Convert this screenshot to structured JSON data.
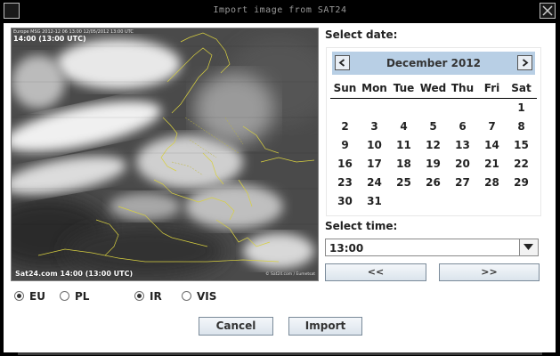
{
  "window": {
    "title": "Import image from SAT24"
  },
  "image": {
    "top_line1": "Europe MSG 2012-12 06 13:00 12/05/2012 13:00 UTC",
    "top_line2": "14:00 (13:00 UTC)",
    "caption": "Sat24.com 14:00 (13:00 UTC)",
    "copyright": "© Sat24.com / Eumetsat"
  },
  "date": {
    "label": "Select date:",
    "month_title": "December 2012",
    "weekdays": [
      "Sun",
      "Mon",
      "Tue",
      "Wed",
      "Thu",
      "Fri",
      "Sat"
    ],
    "days": [
      "1",
      "2",
      "3",
      "4",
      "5",
      "6",
      "7",
      "8",
      "9",
      "10",
      "11",
      "12",
      "13",
      "14",
      "15",
      "16",
      "17",
      "18",
      "19",
      "20",
      "21",
      "22",
      "23",
      "24",
      "25",
      "26",
      "27",
      "28",
      "29",
      "30",
      "31"
    ]
  },
  "time": {
    "label": "Select time:",
    "value": "13:00",
    "prev_label": "<<",
    "next_label": ">>"
  },
  "region": {
    "options": [
      {
        "label": "EU",
        "selected": true
      },
      {
        "label": "PL",
        "selected": false
      }
    ]
  },
  "channel": {
    "options": [
      {
        "label": "IR",
        "selected": true
      },
      {
        "label": "VIS",
        "selected": false
      }
    ]
  },
  "actions": {
    "cancel_label": "Cancel",
    "import_label": "Import"
  }
}
